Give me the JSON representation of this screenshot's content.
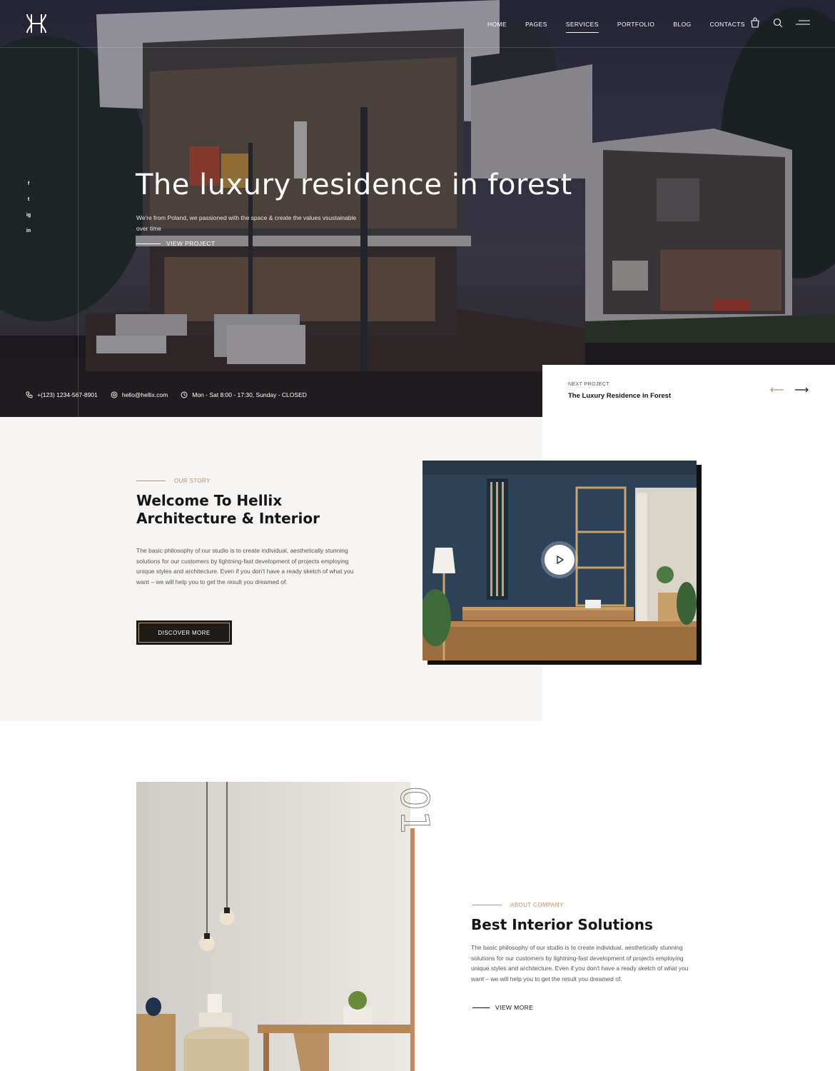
{
  "header": {
    "nav": [
      "HOME",
      "PAGES",
      "SERVICES",
      "PORTFOLIO",
      "BLOG",
      "CONTACTS"
    ],
    "active_nav": "SERVICES",
    "icons": [
      "bag-icon",
      "search-icon",
      "menu-icon"
    ]
  },
  "socials": [
    "f",
    "t",
    "ig",
    "in"
  ],
  "hero": {
    "title": "The luxury residence in forest",
    "lead": "We're from Poland, we passioned with the space & create the values vsustainable over time",
    "cta": "VIEW PROJECT"
  },
  "contact": {
    "phone": "+(123) 1234-567-8901",
    "email": "hello@hellix.com",
    "hours": "Mon - Sat 8:00 - 17:30, Sunday - CLOSED"
  },
  "next_project": {
    "kicker": "NEXT PROJECT",
    "title": "The Luxury Residence in Forest"
  },
  "story": {
    "eyebrow": "OUR STORY",
    "title_line1": "Welcome To Hellix",
    "title_line2": "Architecture & Interior",
    "body": "The basic philosophy of our studio is to create individual, aesthetically stunning solutions for our customers by lightning-fast development of projects employing unique styles and architecture. Even if you don't have a ready sketch of what you want – we will help you to get the result you dreamed of.",
    "button": "DISCOVER MORE"
  },
  "about": {
    "number": "01",
    "eyebrow": "ABOUT COMPANY",
    "title": "Best Interior Solutions",
    "body": "The basic philosophy of our studio is to create individual, aesthetically stunning solutions for our customers by lightning-fast development of projects employing unique styles and architecture. Even if you don't have a ready sketch of what you want – we will help you to get the result you dreamed of.",
    "cta": "VIEW MORE"
  },
  "colors": {
    "accent": "#c6875a",
    "dark": "#1e1a17",
    "story_bg": "#f7f5f3"
  }
}
